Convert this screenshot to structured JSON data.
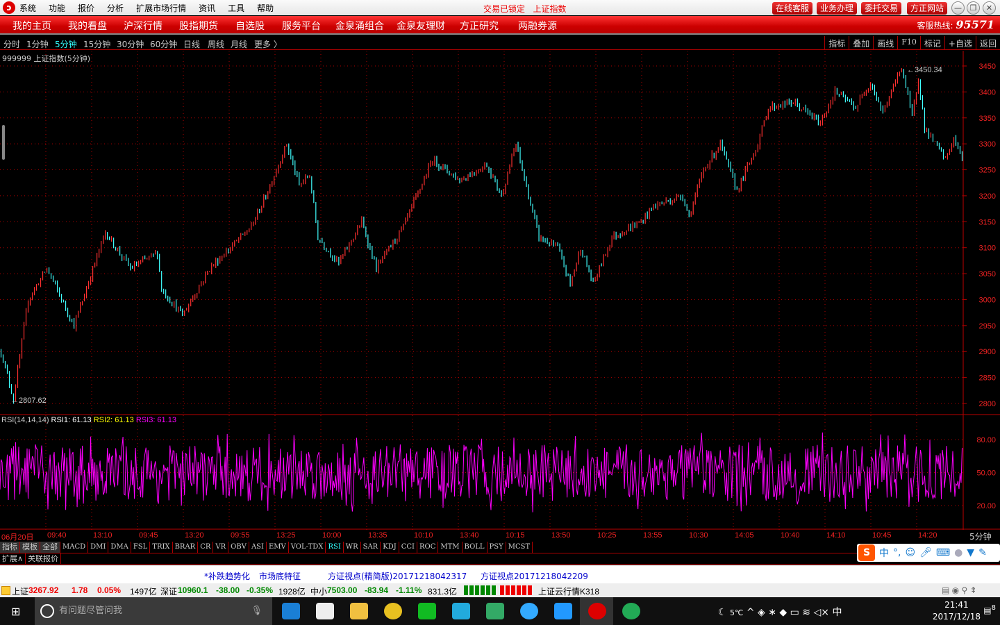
{
  "menubar": {
    "items": [
      "系统",
      "功能",
      "报价",
      "分析",
      "扩展市场行情",
      "资讯",
      "工具",
      "帮助"
    ],
    "lock_status": "交易已锁定",
    "lock_symbol": "上证指数",
    "buttons": [
      "在线客服",
      "业务办理",
      "委托交易",
      "方正网站"
    ]
  },
  "nav": {
    "items": [
      "我的主页",
      "我的看盘",
      "沪深行情",
      "股指期货",
      "自选股",
      "服务平台",
      "金泉涌组合",
      "金泉友理财",
      "方正研究",
      "两融券源"
    ],
    "hotline_label": "客服热线:",
    "hotline_number": "95571"
  },
  "period": {
    "items": [
      "分时",
      "1分钟",
      "5分钟",
      "15分钟",
      "30分钟",
      "60分钟",
      "日线",
      "周线",
      "月线",
      "更多 〉"
    ],
    "active": "5分钟"
  },
  "tools": [
    "指标",
    "叠加",
    "画线",
    "F10",
    "标记",
    "+自选",
    "返回"
  ],
  "chart_title": "999999 上证指数(5分钟)",
  "chart_data": {
    "type": "candlestick-line",
    "title": "999999 上证指数(5分钟)",
    "yticks": [
      3450,
      3400,
      3350,
      3300,
      3250,
      3200,
      3150,
      3100,
      3050,
      3000,
      2950,
      2900,
      2850,
      2800
    ],
    "ylim": [
      2800,
      3450
    ],
    "max_label": "3450.34",
    "min_label": "2807.62",
    "bars_total": 462,
    "key_points": [
      [
        0,
        2900
      ],
      [
        6,
        2808
      ],
      [
        13,
        3000
      ],
      [
        22,
        3060
      ],
      [
        35,
        2950
      ],
      [
        50,
        3130
      ],
      [
        62,
        3060
      ],
      [
        75,
        3090
      ],
      [
        77,
        3020
      ],
      [
        87,
        2970
      ],
      [
        100,
        3060
      ],
      [
        110,
        3100
      ],
      [
        120,
        3140
      ],
      [
        127,
        3200
      ],
      [
        137,
        3300
      ],
      [
        143,
        3220
      ],
      [
        148,
        3240
      ],
      [
        152,
        3120
      ],
      [
        162,
        3070
      ],
      [
        173,
        3150
      ],
      [
        180,
        3060
      ],
      [
        193,
        3140
      ],
      [
        207,
        3270
      ],
      [
        220,
        3230
      ],
      [
        233,
        3260
      ],
      [
        240,
        3200
      ],
      [
        247,
        3300
      ],
      [
        253,
        3200
      ],
      [
        258,
        3120
      ],
      [
        267,
        3100
      ],
      [
        273,
        3030
      ],
      [
        278,
        3100
      ],
      [
        284,
        3030
      ],
      [
        293,
        3120
      ],
      [
        307,
        3150
      ],
      [
        313,
        3180
      ],
      [
        327,
        3200
      ],
      [
        330,
        3160
      ],
      [
        337,
        3250
      ],
      [
        345,
        3300
      ],
      [
        353,
        3210
      ],
      [
        363,
        3300
      ],
      [
        368,
        3370
      ],
      [
        380,
        3380
      ],
      [
        393,
        3340
      ],
      [
        400,
        3400
      ],
      [
        410,
        3370
      ],
      [
        417,
        3420
      ],
      [
        423,
        3360
      ],
      [
        432,
        3450
      ],
      [
        437,
        3350
      ],
      [
        440,
        3430
      ],
      [
        443,
        3330
      ],
      [
        453,
        3270
      ],
      [
        457,
        3310
      ],
      [
        462,
        3260
      ]
    ],
    "xticks": [
      "06月20日",
      "09:40",
      "13:10",
      "09:45",
      "13:20",
      "09:55",
      "13:25",
      "10:00",
      "13:35",
      "10:10",
      "13:40",
      "10:15",
      "13:50",
      "10:25",
      "13:55",
      "10:30",
      "14:05",
      "10:40",
      "14:10",
      "10:45",
      "14:20"
    ],
    "period_label": "5分钟",
    "rsi": {
      "label": "RSI(14,14,14)",
      "rsi1": "RSI1: 61.13",
      "rsi2": "RSI2: 61.13",
      "rsi3": "RSI3: 61.13",
      "yticks": [
        "80.00",
        "50.00",
        "20.00"
      ],
      "ylim": [
        0,
        100
      ],
      "mean": 50,
      "range": [
        15,
        88
      ]
    },
    "colors": {
      "up": "#ff3030",
      "down": "#40ffff",
      "rsi": "#ff00ff",
      "grid": "#b00000"
    }
  },
  "indicators": [
    "指标",
    "模板",
    "全部",
    "MACD",
    "DMI",
    "DMA",
    "FSL",
    "TRIX",
    "BRAR",
    "CR",
    "VR",
    "OBV",
    "ASI",
    "EMV",
    "VOL-TDX",
    "RSI",
    "WR",
    "SAR",
    "KDJ",
    "CCI",
    "ROC",
    "MTM",
    "BOLL",
    "PSY",
    "MCST"
  ],
  "active_indicator": "RSI",
  "ext": [
    "扩展∧",
    "关联报价"
  ],
  "news": [
    "*补跌趋势化",
    "市场底特征",
    "方证视点(精简版)20171218042317",
    "方证视点20171218042209"
  ],
  "status": {
    "sh_name": "上证",
    "sh_val": "3267.92",
    "sh_chg": "1.78",
    "sh_pct": "0.05%",
    "sh_amt": "1497亿",
    "sz_name": "深证",
    "sz_val": "10960.1",
    "sz_chg": "-38.00",
    "sz_pct": "-0.35%",
    "sz_amt": "1928亿",
    "zx_name": "中小",
    "zx_val": "7503.00",
    "zx_chg": "-83.94",
    "zx_pct": "-1.11%",
    "zx_amt": "831.3亿",
    "feed": "上证云行情K318"
  },
  "ime": {
    "logo": "S",
    "mode": "中",
    "punct": "°,"
  },
  "taskbar": {
    "search_placeholder": "有问题尽管问我",
    "weather": "5℃",
    "ime": "中",
    "time": "21:41",
    "date": "2017/12/18",
    "notifications": "8"
  }
}
